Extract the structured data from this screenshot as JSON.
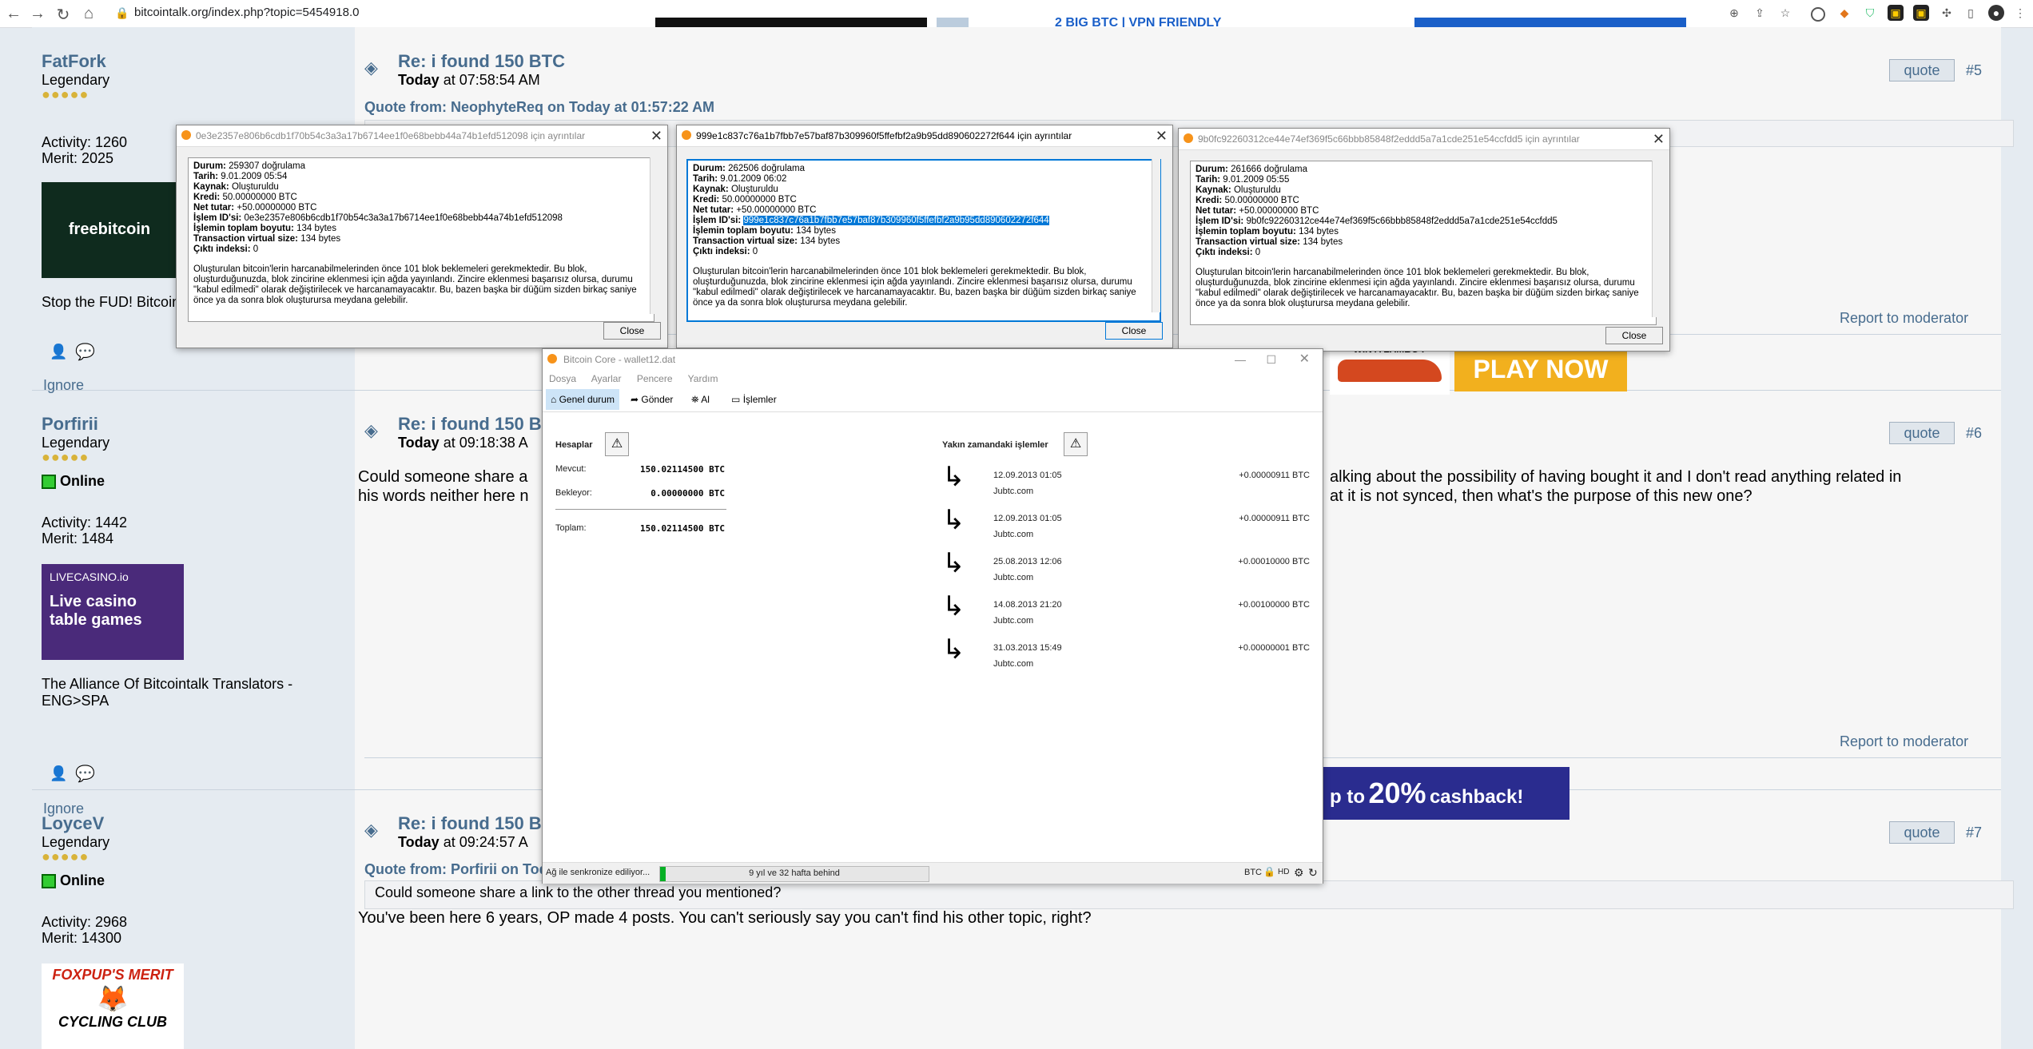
{
  "browser": {
    "url": "bitcointalk.org/index.php?topic=5454918.0",
    "ad_text": "2 BIG BTC | VPN FRIENDLY"
  },
  "posts": [
    {
      "username": "FatFork",
      "rank": "Legendary",
      "activity": "Activity: 1260",
      "merit": "Merit: 2025",
      "avatar_text": "freebitcoin",
      "signature": "Stop the FUD! Bitcoin",
      "title": "Re: i found 150 BTC",
      "date_bold": "Today",
      "date_rest": "at 07:58:54 AM",
      "quote_header": "Quote from: NeophyteReq on Today at 01:57:22 AM",
      "quote_label": "quote",
      "post_number": "#5",
      "report": "Report to moderator",
      "ignore": "Ignore"
    },
    {
      "username": "Porfirii",
      "rank": "Legendary",
      "status": "Online",
      "activity": "Activity: 1442",
      "merit": "Merit: 1484",
      "avatar_line1": "LIVECASINO.io",
      "avatar_line2": "Live casino",
      "avatar_line3": "table games",
      "signature": "The Alliance Of Bitcointalk Translators - ENG>SPA",
      "title": "Re: i found 150 B",
      "date_bold": "Today",
      "date_rest": "at 09:18:38 A",
      "body_left_1": "Could someone share a",
      "body_left_2": "his words neither here n",
      "body_right_1": "alking about the possibility of having bought it and I don't read anything related in",
      "body_right_2": "at it is not synced, then what's the purpose of this new one?",
      "quote_label": "quote",
      "post_number": "#6",
      "report": "Report to moderator",
      "ignore": "Ignore"
    },
    {
      "username": "LoyceV",
      "rank": "Legendary",
      "status": "Online",
      "activity": "Activity: 2968",
      "merit": "Merit: 14300",
      "avatar_line1": "FOXPUP'S MERIT",
      "avatar_line2": "CYCLING CLUB",
      "title": "Re: i found 150 B",
      "date_bold": "Today",
      "date_rest": "at 09:24:57 A",
      "quote_header": "Quote from: Porfirii on Tod",
      "quote_body": "Could someone share a link to the other thread you mentioned?",
      "body": "You've been here 6 years, OP made 4 posts. You can't seriously say you can't find his other topic, right?",
      "quote_label": "quote",
      "post_number": "#7"
    }
  ],
  "ads": {
    "lambo": "WIN A LAMBO !",
    "play_now": "PLAY NOW",
    "cashback_pre": "p to",
    "cashback_pct": "20%",
    "cashback_post": "cashback!"
  },
  "tx_windows": [
    {
      "title": "0e3e2357e806b6cdb1f70b54c3a3a17b6714ee1f0e68bebb44a74b1efd512098 için ayrıntılar",
      "durum": "259307 doğrulama",
      "tarih": "9.01.2009 05:54",
      "txid": "0e3e2357e806b6cdb1f70b54c3a3a17b6714ee1f0e68bebb44a74b1efd512098"
    },
    {
      "title": "999e1c837c76a1b7fbb7e57baf87b309960f5ffefbf2a9b95dd890602272f644 için ayrıntılar",
      "durum": "262506 doğrulama",
      "tarih": "9.01.2009 06:02",
      "txid": "999e1c837c76a1b7fbb7e57baf87b309960f5ffefbf2a9b95dd890602272f644"
    },
    {
      "title": "9b0fc92260312ce44e74ef369f5c66bbb85848f2eddd5a7a1cde251e54ccfdd5 için ayrıntılar",
      "durum": "261666 doğrulama",
      "tarih": "9.01.2009 05:55",
      "txid": "9b0fc92260312ce44e74ef369f5c66bbb85848f2eddd5a7a1cde251e54ccfdd5"
    }
  ],
  "tx_common": {
    "l_durum": "Durum:",
    "l_tarih": "Tarih:",
    "l_kaynak": "Kaynak:",
    "kaynak": "Oluşturuldu",
    "l_kredi": "Kredi:",
    "kredi": "50.00000000 BTC",
    "l_net": "Net tutar:",
    "net": "+50.00000000 BTC",
    "l_txid": "İşlem ID'si:",
    "l_size": "İşlemin toplam boyutu:",
    "size": "134 bytes",
    "l_vsize": "Transaction virtual size:",
    "vsize": "134 bytes",
    "l_out": "Çıktı indeksi:",
    "out": "0",
    "note": "Oluşturulan bitcoin'lerin harcanabilmelerinden önce 101 blok beklemeleri gerekmektedir. Bu blok, oluşturduğunuzda, blok zincirine eklenmesi için ağda yayınlandı. Zincire eklenmesi başarısız olursa, durumu \"kabul edilmedi\" olarak değiştirilecek ve harcanamayacaktır. Bu, bazen başka bir düğüm sizden birkaç saniye önce ya da sonra blok oluşturursa meydana gelebilir.",
    "close": "Close"
  },
  "core": {
    "title": "Bitcoin Core - wallet12.dat",
    "menu": [
      "Dosya",
      "Ayarlar",
      "Pencere",
      "Yardım"
    ],
    "tabs": [
      "Genel durum",
      "Gönder",
      "Al",
      "İşlemler"
    ],
    "balances_title": "Hesaplar",
    "available_label": "Mevcut:",
    "available": "150.02114500 BTC",
    "pending_label": "Bekleyor:",
    "pending": "0.00000000 BTC",
    "total_label": "Toplam:",
    "total": "150.02114500 BTC",
    "recent_title": "Yakın zamandaki işlemler",
    "recent": [
      {
        "date": "12.09.2013 01:05",
        "label": "Jubtc.com",
        "amount": "+0.00000911 BTC"
      },
      {
        "date": "12.09.2013 01:05",
        "label": "Jubtc.com",
        "amount": "+0.00000911 BTC"
      },
      {
        "date": "25.08.2013 12:06",
        "label": "Jubtc.com",
        "amount": "+0.00010000 BTC"
      },
      {
        "date": "14.08.2013 21:20",
        "label": "Jubtc.com",
        "amount": "+0.00100000 BTC"
      },
      {
        "date": "31.03.2013 15:49",
        "label": "Jubtc.com",
        "amount": "+0.00000001 BTC"
      }
    ],
    "sync_label": "Ağ ile senkronize ediliyor...",
    "sync_progress_text": "9 yıl ve 32 hafta behind",
    "sync_progress": 0.02,
    "unit": "BTC",
    "hd": "HD"
  }
}
